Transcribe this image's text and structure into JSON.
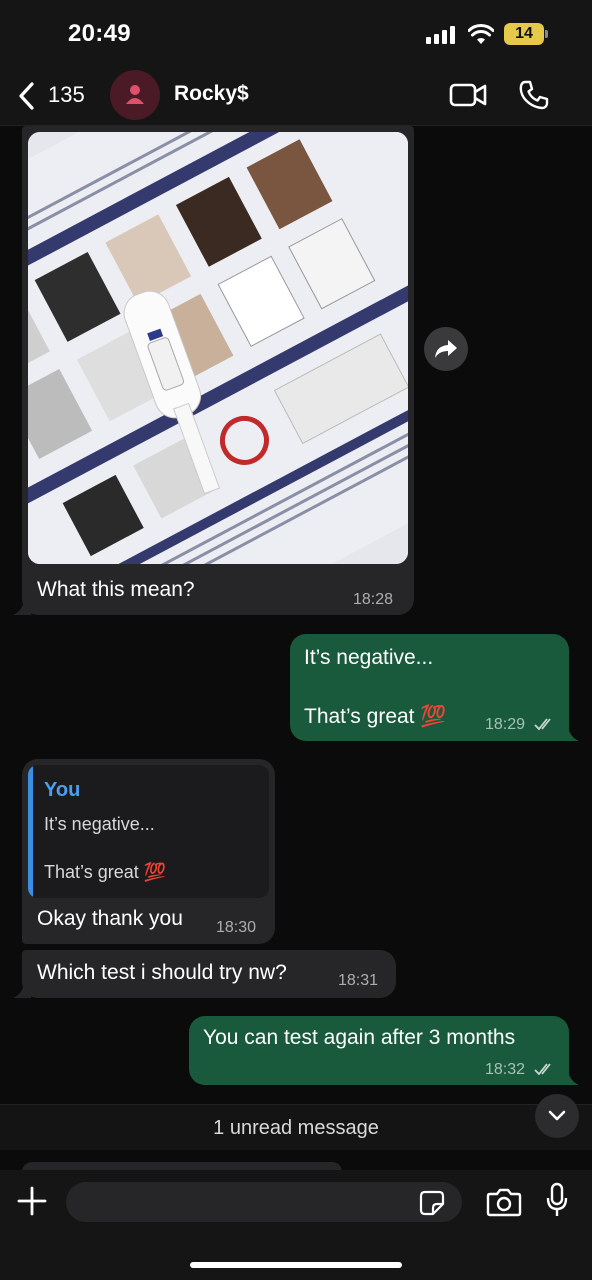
{
  "status_bar": {
    "time": "20:49",
    "battery": "14"
  },
  "header": {
    "back_count": "135",
    "contact_name": "Rocky$"
  },
  "messages": [
    {
      "type": "image",
      "direction": "incoming",
      "caption": "What this mean?",
      "time": "18:28"
    },
    {
      "type": "text",
      "direction": "outgoing",
      "lines": [
        "It’s negative...",
        "That’s great 💯"
      ],
      "time": "18:29",
      "read": true
    },
    {
      "type": "reply",
      "direction": "incoming",
      "quote_author": "You",
      "quote_lines": [
        "It’s negative...",
        "That’s great 💯"
      ],
      "text": "Okay thank you",
      "time": "18:30"
    },
    {
      "type": "text",
      "direction": "incoming",
      "text": "Which test i should try nw?",
      "time": "18:31"
    },
    {
      "type": "text",
      "direction": "outgoing",
      "text": "You can test again after 3 months",
      "time": "18:32",
      "read": true
    }
  ],
  "unread": {
    "label": "1 unread message"
  },
  "input": {
    "placeholder": ""
  },
  "colors": {
    "incoming_bubble": "#262628",
    "outgoing_bubble": "#185a3b",
    "quote_accent": "#4c9ef0",
    "background": "#0b0b0b"
  }
}
